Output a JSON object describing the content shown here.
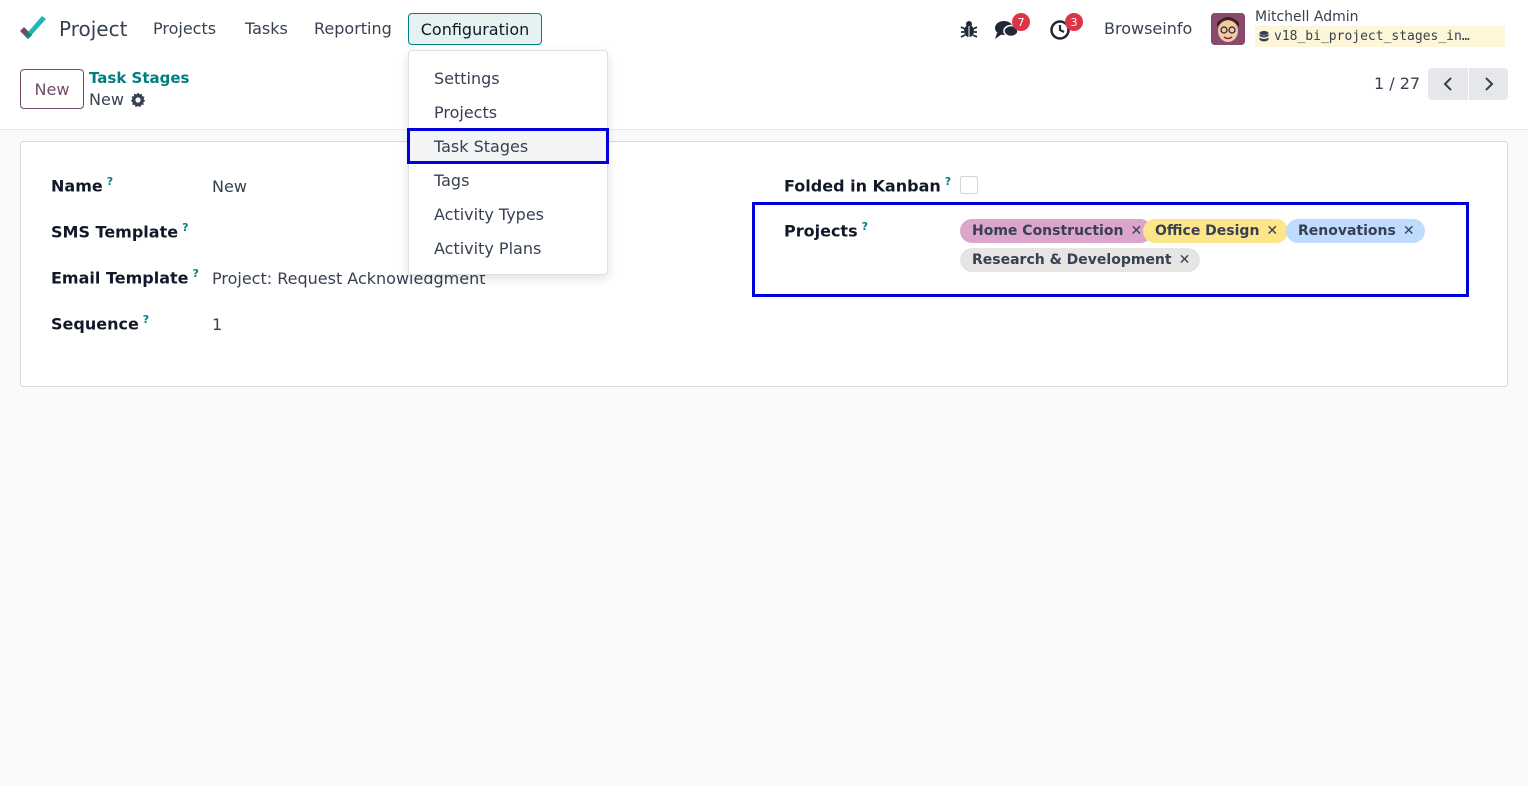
{
  "app": {
    "name": "Project"
  },
  "navbar": {
    "menus": [
      "Projects",
      "Tasks",
      "Reporting"
    ],
    "active_menu": "Configuration",
    "messages_count": "7",
    "activities_count": "3",
    "company": "Browseinfo",
    "user_name": "Mitchell Admin",
    "database": "v18_bi_project_stages_in…"
  },
  "control_panel": {
    "new_button": "New",
    "breadcrumb": "Task Stages",
    "record_name": "New",
    "pager": "1 / 27"
  },
  "form": {
    "fields": [
      {
        "label": "Name",
        "value": "New"
      },
      {
        "label": "SMS Template",
        "value": ""
      },
      {
        "label": "Email Template",
        "value": "Project: Request Acknowledgment"
      },
      {
        "label": "Sequence",
        "value": "1"
      }
    ],
    "folded_label": "Folded in Kanban",
    "folded_value": false,
    "projects_label": "Projects",
    "project_tags": [
      {
        "name": "Home Construction",
        "color": "#dba5cc"
      },
      {
        "name": "Office Design",
        "color": "#fde68a"
      },
      {
        "name": "Renovations",
        "color": "#bfdbfe"
      },
      {
        "name": "Research & Development",
        "color": "#e7e5e4"
      }
    ]
  },
  "dropdown": {
    "items": [
      "Settings",
      "Projects",
      "Task Stages",
      "Tags",
      "Activity Types",
      "Activity Plans"
    ],
    "active_index": 2
  },
  "colors": {
    "accent": "#017e84",
    "brand": "#714b67",
    "highlight": "#0000dd",
    "badge": "#dc3545"
  }
}
